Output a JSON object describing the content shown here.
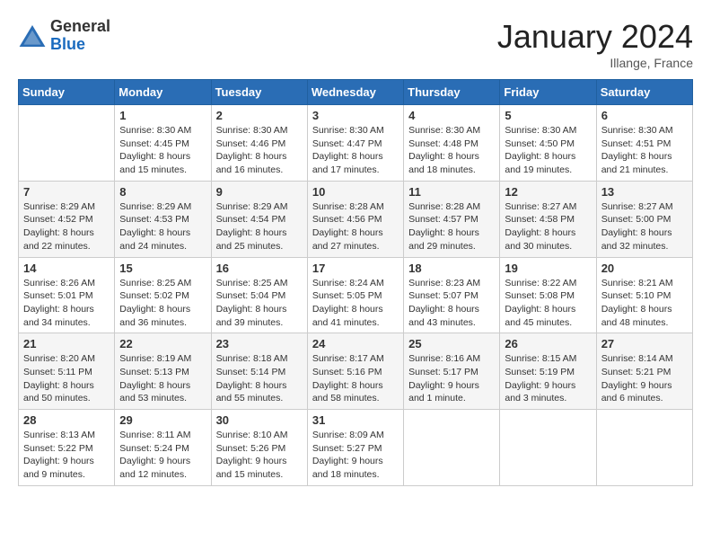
{
  "logo": {
    "general": "General",
    "blue": "Blue"
  },
  "header": {
    "month": "January 2024",
    "location": "Illange, France"
  },
  "weekdays": [
    "Sunday",
    "Monday",
    "Tuesday",
    "Wednesday",
    "Thursday",
    "Friday",
    "Saturday"
  ],
  "weeks": [
    [
      {
        "day": "",
        "sunrise": "",
        "sunset": "",
        "daylight": ""
      },
      {
        "day": "1",
        "sunrise": "Sunrise: 8:30 AM",
        "sunset": "Sunset: 4:45 PM",
        "daylight": "Daylight: 8 hours and 15 minutes."
      },
      {
        "day": "2",
        "sunrise": "Sunrise: 8:30 AM",
        "sunset": "Sunset: 4:46 PM",
        "daylight": "Daylight: 8 hours and 16 minutes."
      },
      {
        "day": "3",
        "sunrise": "Sunrise: 8:30 AM",
        "sunset": "Sunset: 4:47 PM",
        "daylight": "Daylight: 8 hours and 17 minutes."
      },
      {
        "day": "4",
        "sunrise": "Sunrise: 8:30 AM",
        "sunset": "Sunset: 4:48 PM",
        "daylight": "Daylight: 8 hours and 18 minutes."
      },
      {
        "day": "5",
        "sunrise": "Sunrise: 8:30 AM",
        "sunset": "Sunset: 4:50 PM",
        "daylight": "Daylight: 8 hours and 19 minutes."
      },
      {
        "day": "6",
        "sunrise": "Sunrise: 8:30 AM",
        "sunset": "Sunset: 4:51 PM",
        "daylight": "Daylight: 8 hours and 21 minutes."
      }
    ],
    [
      {
        "day": "7",
        "sunrise": "Sunrise: 8:29 AM",
        "sunset": "Sunset: 4:52 PM",
        "daylight": "Daylight: 8 hours and 22 minutes."
      },
      {
        "day": "8",
        "sunrise": "Sunrise: 8:29 AM",
        "sunset": "Sunset: 4:53 PM",
        "daylight": "Daylight: 8 hours and 24 minutes."
      },
      {
        "day": "9",
        "sunrise": "Sunrise: 8:29 AM",
        "sunset": "Sunset: 4:54 PM",
        "daylight": "Daylight: 8 hours and 25 minutes."
      },
      {
        "day": "10",
        "sunrise": "Sunrise: 8:28 AM",
        "sunset": "Sunset: 4:56 PM",
        "daylight": "Daylight: 8 hours and 27 minutes."
      },
      {
        "day": "11",
        "sunrise": "Sunrise: 8:28 AM",
        "sunset": "Sunset: 4:57 PM",
        "daylight": "Daylight: 8 hours and 29 minutes."
      },
      {
        "day": "12",
        "sunrise": "Sunrise: 8:27 AM",
        "sunset": "Sunset: 4:58 PM",
        "daylight": "Daylight: 8 hours and 30 minutes."
      },
      {
        "day": "13",
        "sunrise": "Sunrise: 8:27 AM",
        "sunset": "Sunset: 5:00 PM",
        "daylight": "Daylight: 8 hours and 32 minutes."
      }
    ],
    [
      {
        "day": "14",
        "sunrise": "Sunrise: 8:26 AM",
        "sunset": "Sunset: 5:01 PM",
        "daylight": "Daylight: 8 hours and 34 minutes."
      },
      {
        "day": "15",
        "sunrise": "Sunrise: 8:25 AM",
        "sunset": "Sunset: 5:02 PM",
        "daylight": "Daylight: 8 hours and 36 minutes."
      },
      {
        "day": "16",
        "sunrise": "Sunrise: 8:25 AM",
        "sunset": "Sunset: 5:04 PM",
        "daylight": "Daylight: 8 hours and 39 minutes."
      },
      {
        "day": "17",
        "sunrise": "Sunrise: 8:24 AM",
        "sunset": "Sunset: 5:05 PM",
        "daylight": "Daylight: 8 hours and 41 minutes."
      },
      {
        "day": "18",
        "sunrise": "Sunrise: 8:23 AM",
        "sunset": "Sunset: 5:07 PM",
        "daylight": "Daylight: 8 hours and 43 minutes."
      },
      {
        "day": "19",
        "sunrise": "Sunrise: 8:22 AM",
        "sunset": "Sunset: 5:08 PM",
        "daylight": "Daylight: 8 hours and 45 minutes."
      },
      {
        "day": "20",
        "sunrise": "Sunrise: 8:21 AM",
        "sunset": "Sunset: 5:10 PM",
        "daylight": "Daylight: 8 hours and 48 minutes."
      }
    ],
    [
      {
        "day": "21",
        "sunrise": "Sunrise: 8:20 AM",
        "sunset": "Sunset: 5:11 PM",
        "daylight": "Daylight: 8 hours and 50 minutes."
      },
      {
        "day": "22",
        "sunrise": "Sunrise: 8:19 AM",
        "sunset": "Sunset: 5:13 PM",
        "daylight": "Daylight: 8 hours and 53 minutes."
      },
      {
        "day": "23",
        "sunrise": "Sunrise: 8:18 AM",
        "sunset": "Sunset: 5:14 PM",
        "daylight": "Daylight: 8 hours and 55 minutes."
      },
      {
        "day": "24",
        "sunrise": "Sunrise: 8:17 AM",
        "sunset": "Sunset: 5:16 PM",
        "daylight": "Daylight: 8 hours and 58 minutes."
      },
      {
        "day": "25",
        "sunrise": "Sunrise: 8:16 AM",
        "sunset": "Sunset: 5:17 PM",
        "daylight": "Daylight: 9 hours and 1 minute."
      },
      {
        "day": "26",
        "sunrise": "Sunrise: 8:15 AM",
        "sunset": "Sunset: 5:19 PM",
        "daylight": "Daylight: 9 hours and 3 minutes."
      },
      {
        "day": "27",
        "sunrise": "Sunrise: 8:14 AM",
        "sunset": "Sunset: 5:21 PM",
        "daylight": "Daylight: 9 hours and 6 minutes."
      }
    ],
    [
      {
        "day": "28",
        "sunrise": "Sunrise: 8:13 AM",
        "sunset": "Sunset: 5:22 PM",
        "daylight": "Daylight: 9 hours and 9 minutes."
      },
      {
        "day": "29",
        "sunrise": "Sunrise: 8:11 AM",
        "sunset": "Sunset: 5:24 PM",
        "daylight": "Daylight: 9 hours and 12 minutes."
      },
      {
        "day": "30",
        "sunrise": "Sunrise: 8:10 AM",
        "sunset": "Sunset: 5:26 PM",
        "daylight": "Daylight: 9 hours and 15 minutes."
      },
      {
        "day": "31",
        "sunrise": "Sunrise: 8:09 AM",
        "sunset": "Sunset: 5:27 PM",
        "daylight": "Daylight: 9 hours and 18 minutes."
      },
      {
        "day": "",
        "sunrise": "",
        "sunset": "",
        "daylight": ""
      },
      {
        "day": "",
        "sunrise": "",
        "sunset": "",
        "daylight": ""
      },
      {
        "day": "",
        "sunrise": "",
        "sunset": "",
        "daylight": ""
      }
    ]
  ]
}
